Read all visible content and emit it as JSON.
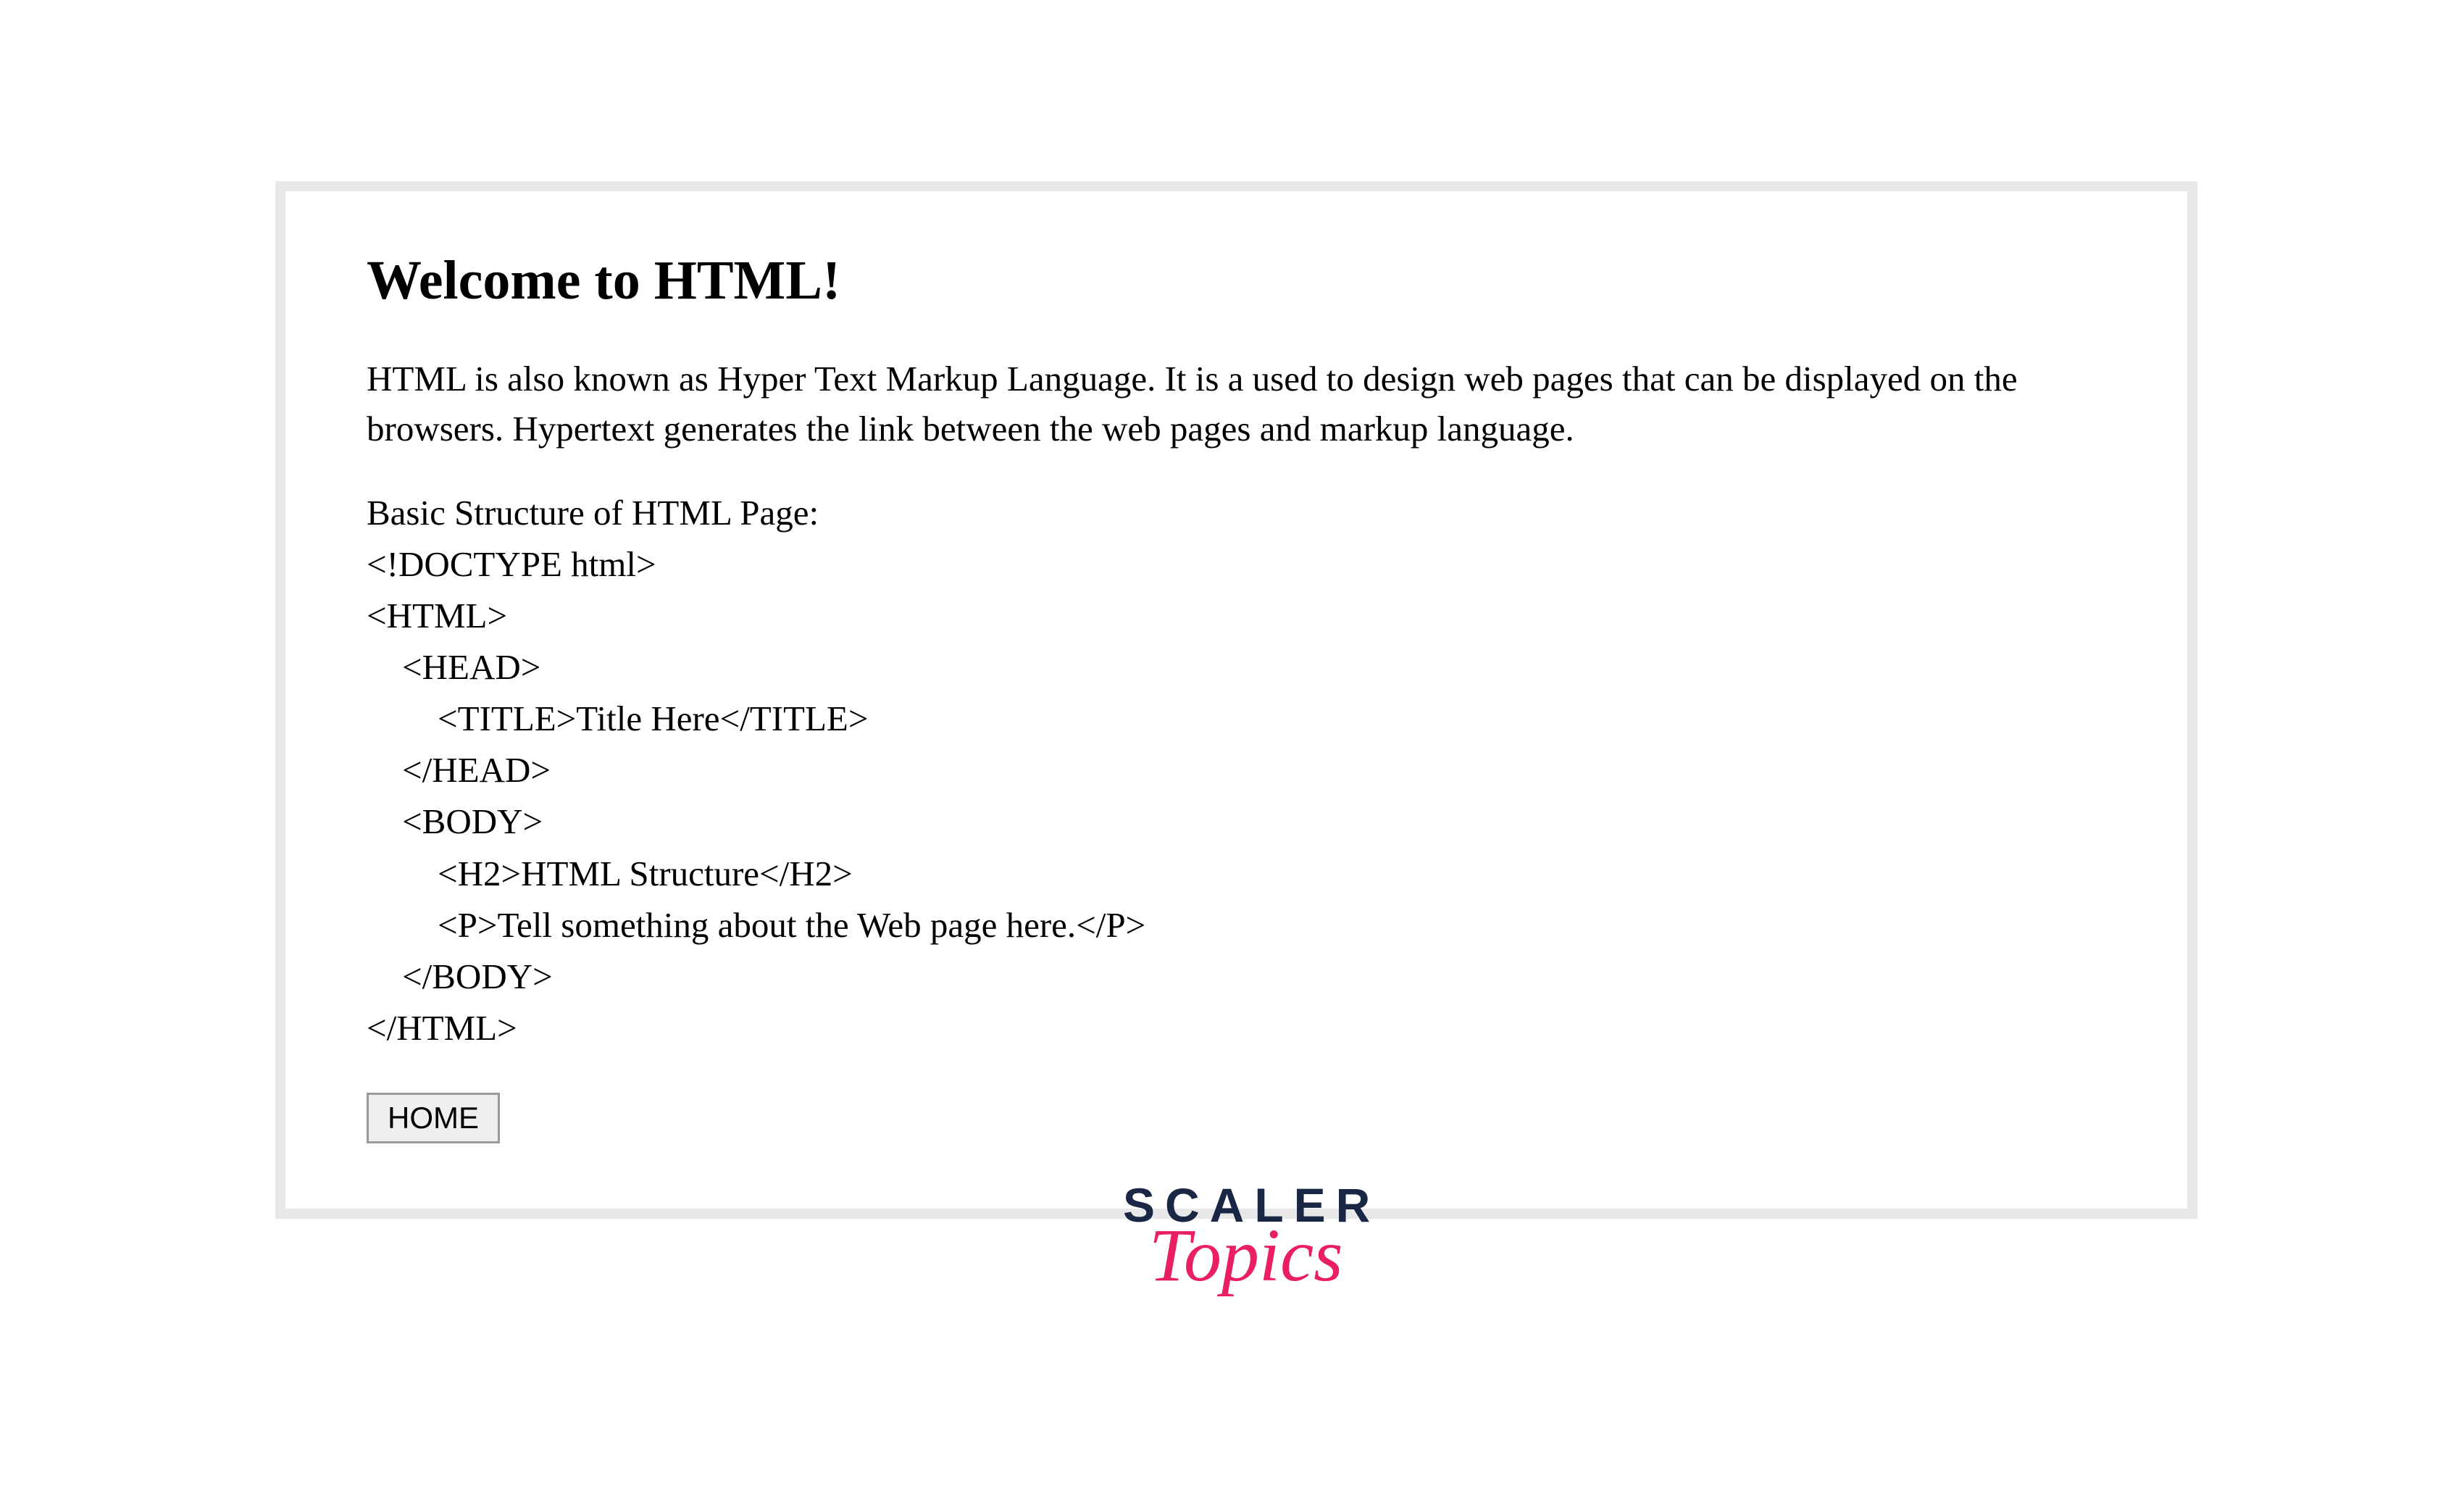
{
  "main": {
    "title": "Welcome to HTML!",
    "intro": "HTML is also known as Hyper Text Markup Language. It is a used to design web pages that can be displayed on the browsers. Hypertext generates the link between the web pages and markup language.",
    "code_sample": "Basic Structure of HTML Page:\n<!DOCTYPE html>\n<HTML>\n    <HEAD>\n        <TITLE>Title Here</TITLE>\n    </HEAD>\n    <BODY>\n        <H2>HTML Structure</H2>\n        <P>Tell something about the Web page here.</P>\n    </BODY>\n</HTML>",
    "home_button": "HOME"
  },
  "logo": {
    "line1": "SCALER",
    "line2": "Topics"
  }
}
